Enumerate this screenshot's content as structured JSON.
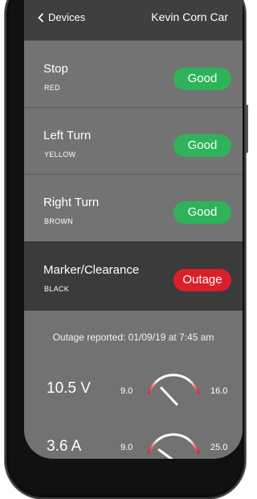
{
  "header": {
    "back_label": "Devices",
    "title": "Kevin Corn Car"
  },
  "lights": [
    {
      "name": "Stop",
      "color": "RED",
      "status": "Good"
    },
    {
      "name": "Left Turn",
      "color": "YELLOW",
      "status": "Good"
    },
    {
      "name": "Right Turn",
      "color": "BROWN",
      "status": "Good"
    },
    {
      "name": "Marker/Clearance",
      "color": "BLACK",
      "status": "Outage"
    }
  ],
  "status_colors": {
    "good": "#2fb35a",
    "outage": "#d9202a"
  },
  "report": "Outage reported: 01/09/19 at 7:45 am",
  "meters": [
    {
      "reading": "10.5 V",
      "min": "9.0",
      "max": "16.0",
      "value": 10.5,
      "min_value": 9.0,
      "max_value": 16.0
    },
    {
      "reading": "3.6 A",
      "min": "9.0",
      "max": "25.0",
      "value": 3.6,
      "min_value": 0.0,
      "max_value": 25.0
    }
  ]
}
